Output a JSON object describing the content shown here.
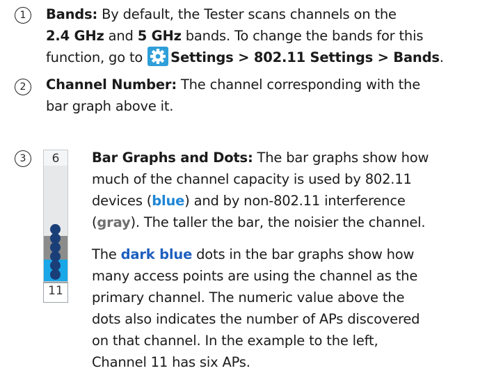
{
  "items": [
    {
      "number": "1",
      "title": "Bands:",
      "line1": " By default, the Tester scans channels on the",
      "line2_b1": "2.4 GHz",
      "line2_t1": " and ",
      "line2_b2": "5 GHz",
      "line2_t2": " bands. To change the bands for this",
      "line3_t1": "function, go to ",
      "settings_path": "Settings > 802.11 Settings > Bands",
      "line3_end": "."
    },
    {
      "number": "2",
      "title": "Channel Number:",
      "line1": " The channel corresponding with the",
      "line2": "bar graph above it."
    },
    {
      "number": "3",
      "title": "Bar Graphs and Dots:",
      "p1_l1": " The bar graphs show how",
      "p1_l2": "much of the channel capacity is used by 802.11",
      "p1_l3a": "devices (",
      "p1_blue": "blue",
      "p1_l3b": ") and by non-802.11 interference",
      "p1_l4a": "(",
      "p1_gray": "gray",
      "p1_l4b": "). The taller the bar, the noisier the channel.",
      "p2_l1a": "The ",
      "p2_darkblue": "dark blue",
      "p2_l1b": " dots in the bar graphs show how",
      "p2_l2": "many access points are using the channel as the",
      "p2_l3": "primary channel. The numeric value above the",
      "p2_l4": "dots also indicates the number of APs discovered",
      "p2_l5": "on that channel. In the example to the left,",
      "p2_l6": "Channel 11 has six APs."
    }
  ],
  "bar_graph": {
    "ap_count": "6",
    "channel": "11",
    "dots": 6,
    "gear_icon": "settings-gear-icon",
    "colors": {
      "wifi": "#19a7e8",
      "interference": "#8c8c8c",
      "dot": "#1a3f78",
      "icon_bg": "#2f9fd9"
    }
  }
}
